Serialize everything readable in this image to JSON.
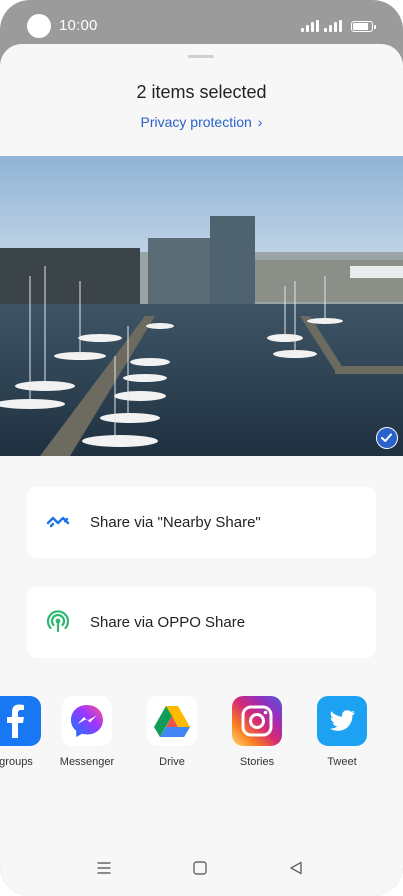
{
  "status_bar": {
    "time": "10:00"
  },
  "header": {
    "title": "2 items selected",
    "privacy_link": "Privacy protection"
  },
  "options": [
    {
      "label": "Share via \"Nearby Share\"",
      "icon": "nearby-share-icon"
    },
    {
      "label": "Share via OPPO Share",
      "icon": "oppo-share-icon"
    }
  ],
  "apps": [
    {
      "name": "groups",
      "icon": "facebook-icon"
    },
    {
      "name": "Messenger",
      "icon": "messenger-icon"
    },
    {
      "name": "Drive",
      "icon": "drive-icon"
    },
    {
      "name": "Stories",
      "icon": "instagram-icon"
    },
    {
      "name": "Tweet",
      "icon": "twitter-icon"
    }
  ],
  "colors": {
    "accent": "#2a62c9",
    "sheet": "#f7f7f7",
    "frame": "#9b9b9b"
  }
}
